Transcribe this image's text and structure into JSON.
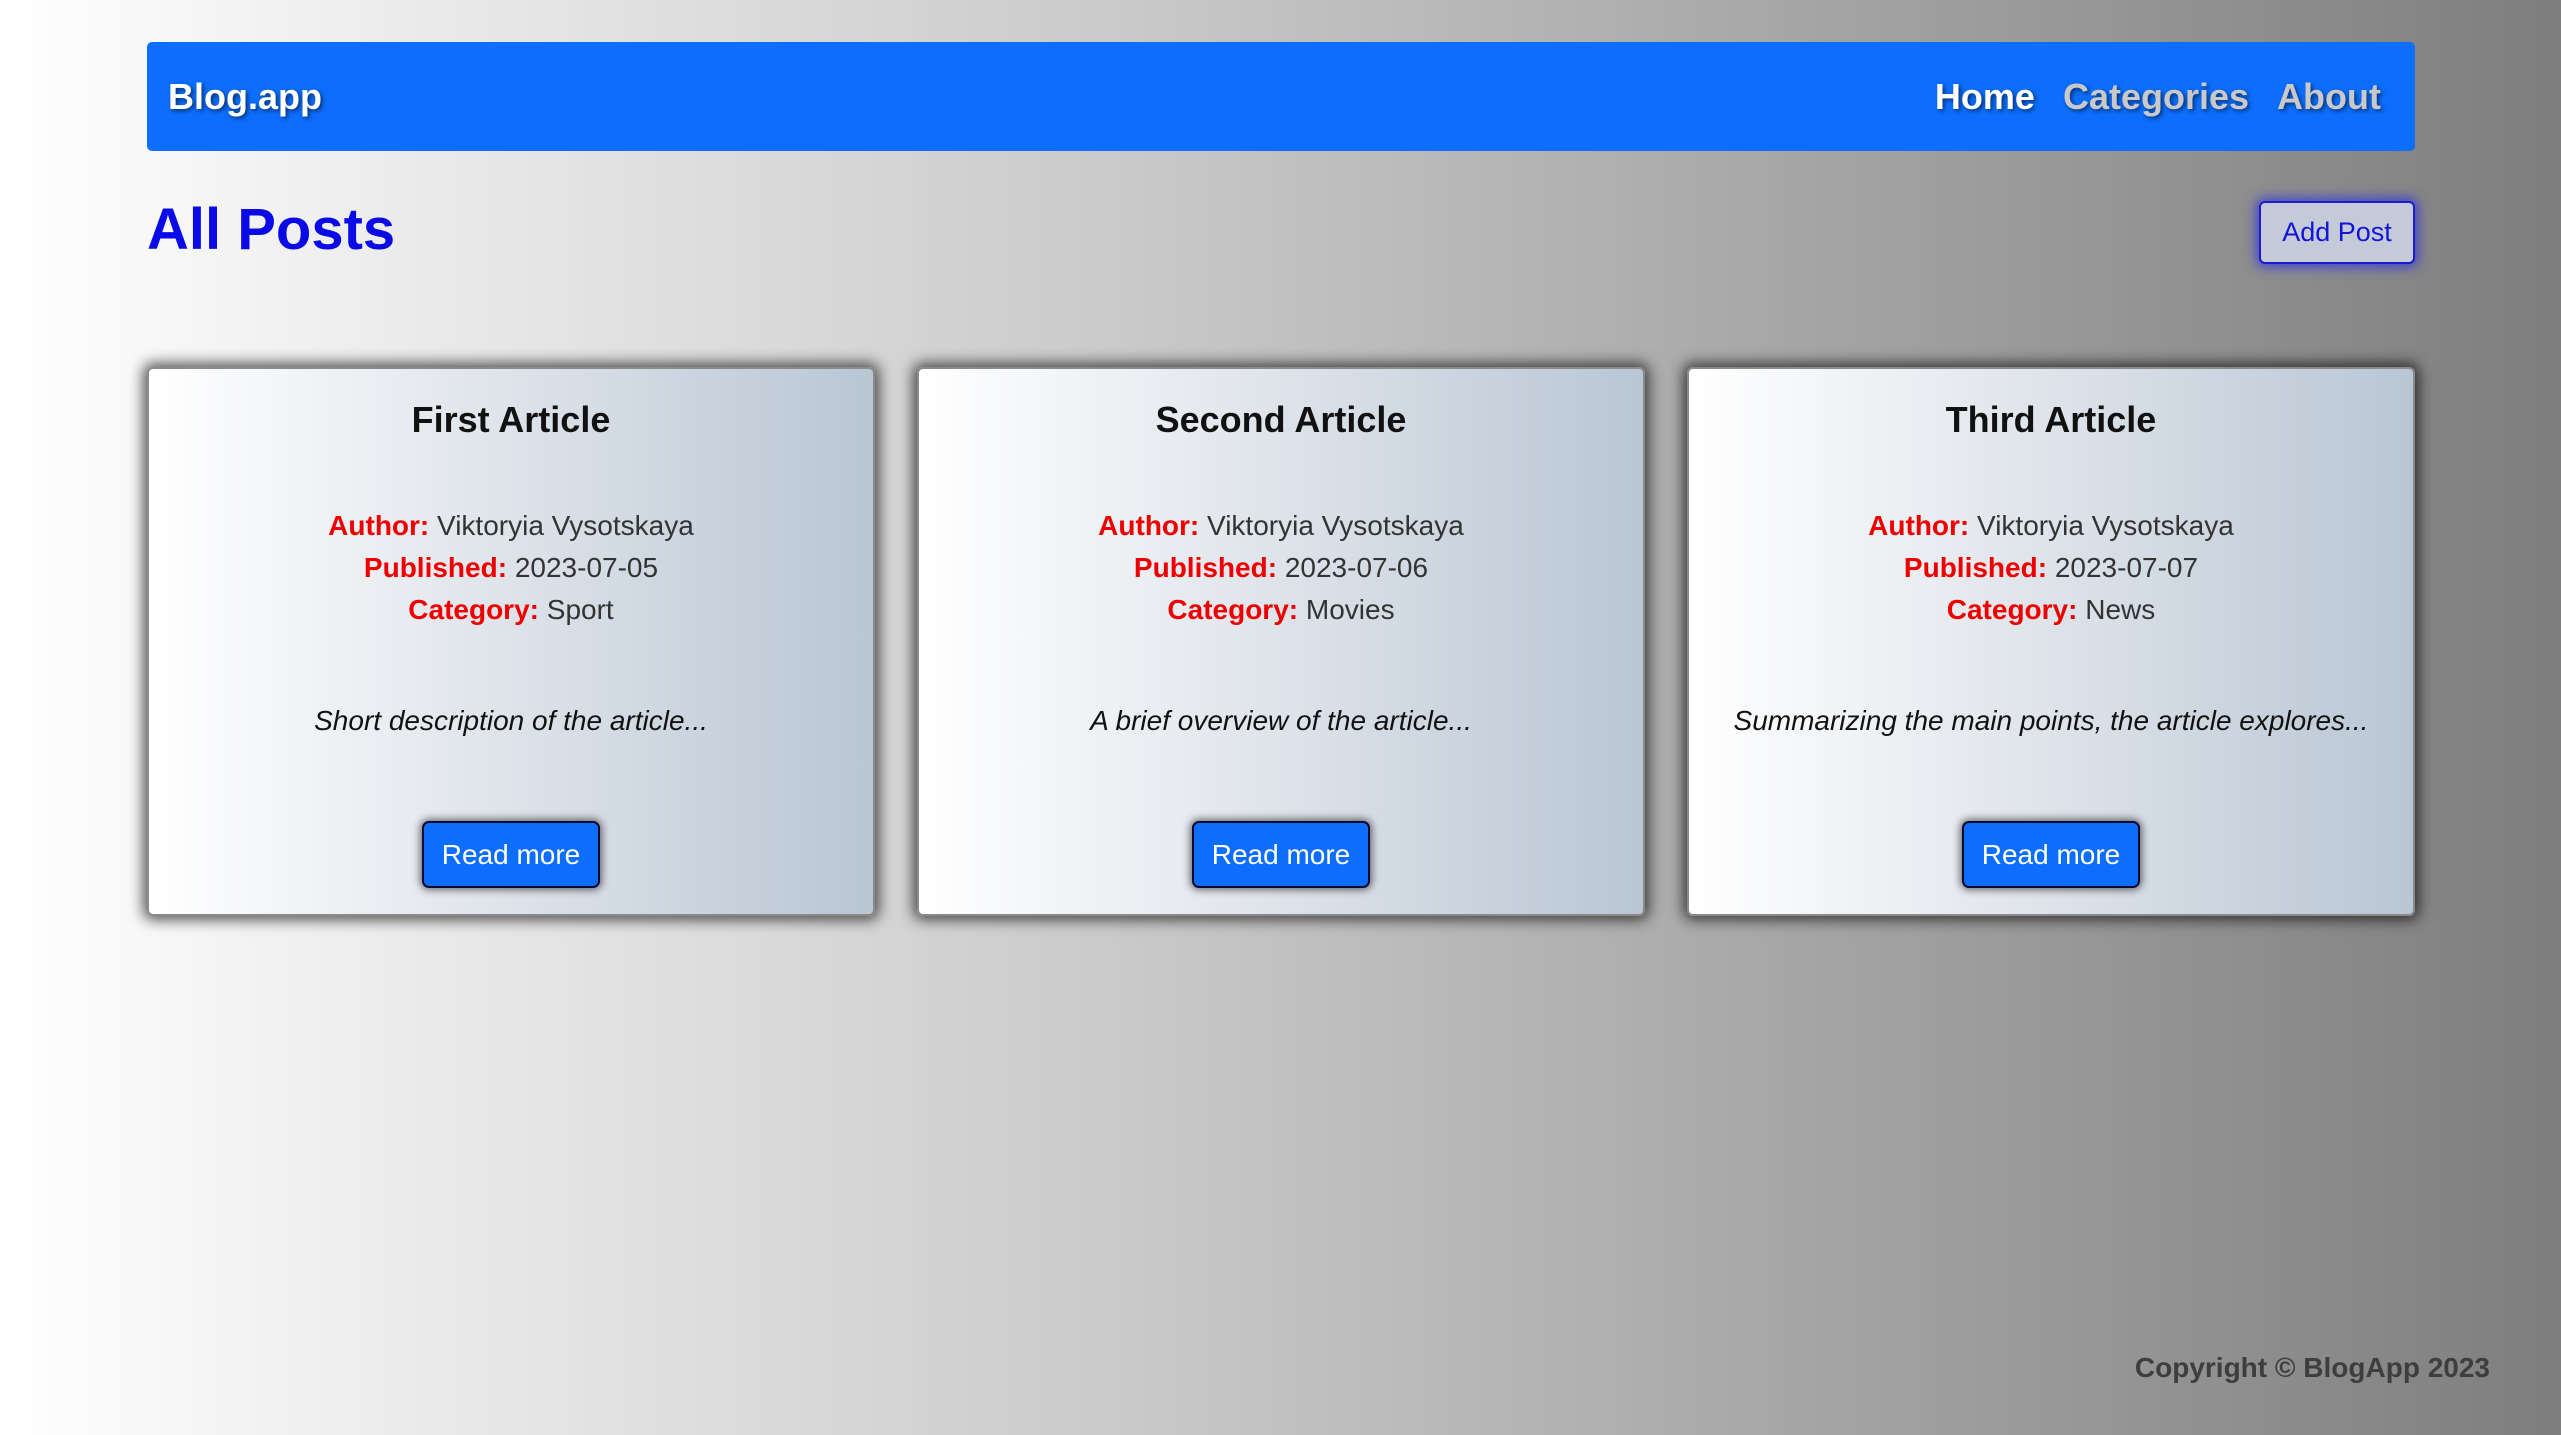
{
  "nav": {
    "brand": "Blog.app",
    "links": [
      {
        "label": "Home",
        "active": true
      },
      {
        "label": "Categories",
        "active": false
      },
      {
        "label": "About",
        "active": false
      }
    ]
  },
  "page": {
    "title": "All Posts",
    "add_post_label": "Add Post"
  },
  "labels": {
    "author": "Author:",
    "published": "Published:",
    "category": "Category:",
    "read_more": "Read more"
  },
  "posts": [
    {
      "title": "First Article",
      "author": "Viktoryia Vysotskaya",
      "published": "2023-07-05",
      "category": "Sport",
      "description": "Short description of the article..."
    },
    {
      "title": "Second Article",
      "author": "Viktoryia Vysotskaya",
      "published": "2023-07-06",
      "category": "Movies",
      "description": "A brief overview of the article..."
    },
    {
      "title": "Third Article",
      "author": "Viktoryia Vysotskaya",
      "published": "2023-07-07",
      "category": "News",
      "description": "Summarizing the main points, the article explores..."
    }
  ],
  "footer": {
    "copyright": "Copyright © BlogApp 2023"
  },
  "colors": {
    "primary": "#0d6efd",
    "title": "#0a0ae6",
    "label_red": "#ee0000"
  }
}
